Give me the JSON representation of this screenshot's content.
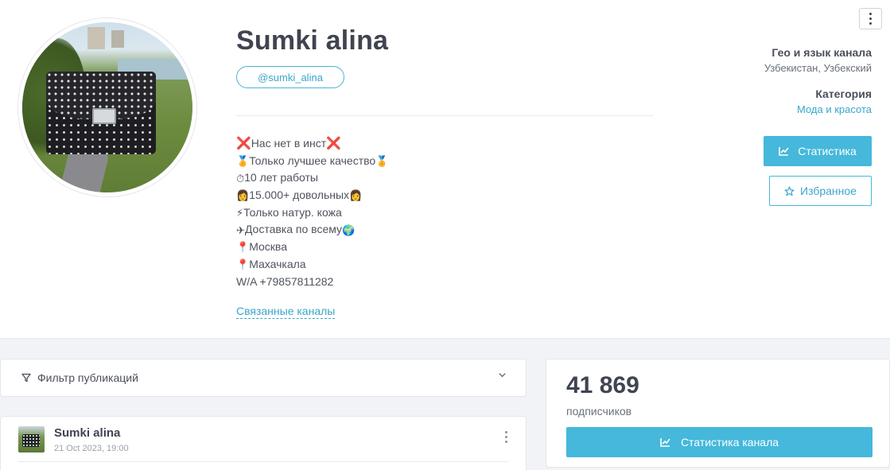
{
  "channel": {
    "name": "Sumki alina",
    "handle": "@sumki_alina",
    "related_link": "Связанные каналы"
  },
  "description": [
    {
      "prefix": "❌",
      "text": "Нас нет в инст",
      "suffix": "❌"
    },
    {
      "prefix": "🏅",
      "text": "Только лучшее качество",
      "suffix": "🏅"
    },
    {
      "prefix": "⏱",
      "text": "10 лет работы",
      "suffix": ""
    },
    {
      "prefix": "👩",
      "text": "15.000+ довольных",
      "suffix": "👩"
    },
    {
      "prefix": "⚡",
      "text": "Только натур. кожа",
      "suffix": ""
    },
    {
      "prefix": "✈",
      "text": "Доставка по всему",
      "suffix": "🌍"
    },
    {
      "prefix": "📍",
      "text": "Москва",
      "suffix": ""
    },
    {
      "prefix": "📍",
      "text": "Махачкала",
      "suffix": ""
    },
    {
      "prefix": "",
      "text": "W/A +79857811282",
      "suffix": ""
    }
  ],
  "info": {
    "geo_label": "Гео и язык канала",
    "geo_value": "Узбекистан, Узбекский",
    "category_label": "Категория",
    "category_value": "Мода и красота"
  },
  "buttons": {
    "stats": "Статистика",
    "favorite": "Избранное",
    "channel_stats": "Статистика канала"
  },
  "filter": {
    "label": "Фильтр публикаций"
  },
  "post": {
    "author": "Sumki alina",
    "date": "21 Oct 2023, 19:00"
  },
  "subscribers": {
    "count": "41 869",
    "label": "подписчиков"
  },
  "colors": {
    "accent": "#45b8db",
    "link": "#3aa6cc",
    "text_dark": "#3f4450",
    "background": "#f1f3f6"
  }
}
